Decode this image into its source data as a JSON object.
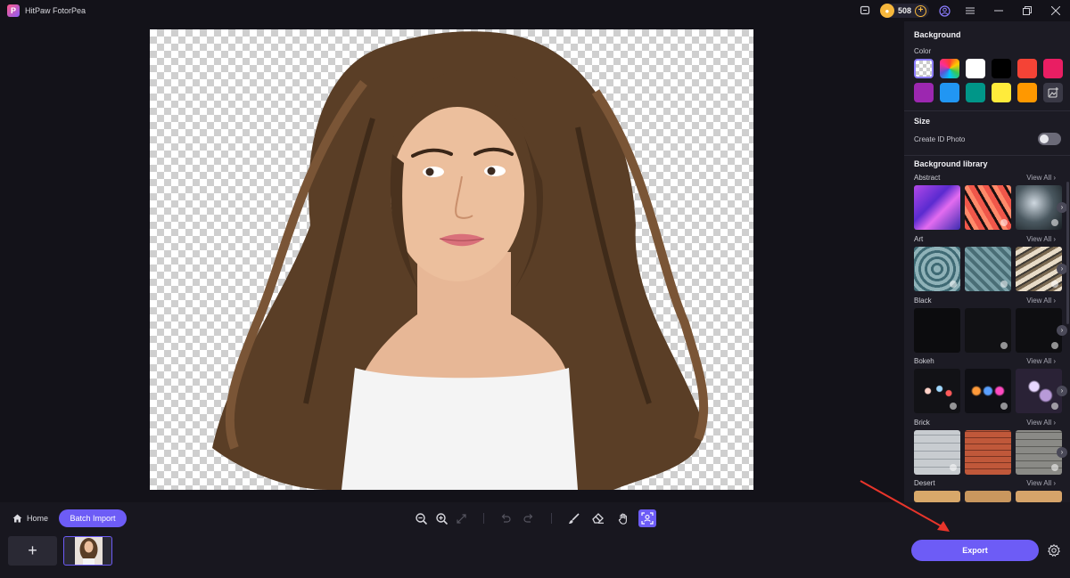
{
  "app": {
    "title": "HitPaw FotorPea",
    "coins": "508"
  },
  "panel": {
    "background_heading": "Background",
    "color_label": "Color",
    "swatches": [
      "transparent",
      "rainbow",
      "#ffffff",
      "#000000",
      "#f44336",
      "#e91e63",
      "#9c27b0",
      "#2196f3",
      "#009688",
      "#ffeb3b",
      "#ff9800",
      "image"
    ],
    "size_heading": "Size",
    "id_photo_label": "Create ID Photo",
    "id_photo_enabled": false,
    "library_heading": "Background library",
    "view_all": "View All",
    "categories": [
      {
        "name": "Abstract"
      },
      {
        "name": "Art"
      },
      {
        "name": "Black"
      },
      {
        "name": "Bokeh"
      },
      {
        "name": "Brick"
      },
      {
        "name": "Desert"
      }
    ]
  },
  "bottom": {
    "home_label": "Home",
    "batch_label": "Batch Import",
    "add_label": "+",
    "export_label": "Export"
  },
  "icons": {
    "home": "home-icon",
    "zoom_out": "zoom-out-icon",
    "zoom_in": "zoom-in-icon",
    "fit": "fit-icon",
    "undo": "undo-icon",
    "redo": "redo-icon",
    "brush": "brush-icon",
    "eraser": "eraser-icon",
    "hand": "hand-icon",
    "select": "auto-select-icon",
    "settings": "gear-icon"
  },
  "colors": {
    "accent": "#6d5cf6",
    "background": "#131219",
    "panel": "#1c1b24"
  }
}
